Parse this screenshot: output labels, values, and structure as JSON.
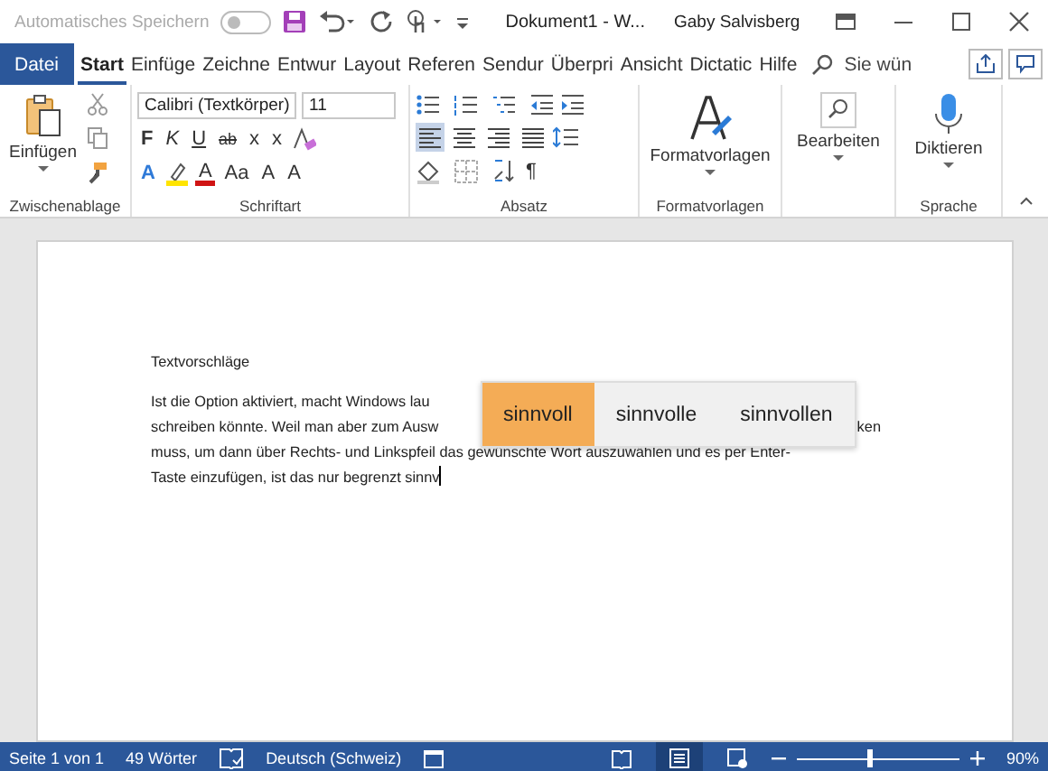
{
  "title_bar": {
    "autosave_label": "Automatisches Speichern",
    "autosave_on": false,
    "document_title": "Dokument1  -  W...",
    "user": "Gaby Salvisberg"
  },
  "tabs": [
    {
      "label": "Datei",
      "kind": "file",
      "selected": false
    },
    {
      "label": "Start",
      "kind": "tab",
      "selected": true
    },
    {
      "label": "Einfüge",
      "kind": "tab",
      "selected": false
    },
    {
      "label": "Zeichne",
      "kind": "tab",
      "selected": false
    },
    {
      "label": "Entwur",
      "kind": "tab",
      "selected": false
    },
    {
      "label": "Layout",
      "kind": "tab",
      "selected": false
    },
    {
      "label": "Referen",
      "kind": "tab",
      "selected": false
    },
    {
      "label": "Sendur",
      "kind": "tab",
      "selected": false
    },
    {
      "label": "Überpri",
      "kind": "tab",
      "selected": false
    },
    {
      "label": "Ansicht",
      "kind": "tab",
      "selected": false
    },
    {
      "label": "Dictatic",
      "kind": "tab",
      "selected": false
    },
    {
      "label": "Hilfe",
      "kind": "tab",
      "selected": false
    }
  ],
  "tell_me": {
    "placeholder": "Sie wün"
  },
  "ribbon": {
    "clipboard": {
      "paste": "Einfügen",
      "group": "Zwischenablage"
    },
    "font": {
      "name": "Calibri (Textkörper)",
      "size": "11",
      "row1": [
        "F",
        "K",
        "U",
        "ab",
        "x",
        "x"
      ],
      "row2": [
        "A",
        "A",
        "Aa",
        "A",
        "A"
      ],
      "group": "Schriftart"
    },
    "paragraph": {
      "alignments": [
        {
          "selected": true
        },
        {
          "selected": false
        },
        {
          "selected": false
        },
        {
          "selected": false
        }
      ],
      "pilcrow": "¶",
      "group": "Absatz"
    },
    "styles": {
      "label": "Formatvorlagen",
      "group": "Formatvorlagen"
    },
    "editing": {
      "label": "Bearbeiten"
    },
    "voice": {
      "label": "Diktieren",
      "group": "Sprache"
    }
  },
  "document": {
    "heading": "Textvorschläge",
    "lines": [
      {
        "left": "Ist die Option aktiviert, macht Windows lau"
      },
      {
        "left": "schreiben könnte. Weil man aber zum Ausw",
        "right": "ken"
      },
      {
        "left": "muss, um dann über Rechts- und Linkspfeil das gewünschte Wort auszuwählen und es per Enter-"
      },
      {
        "left": "Taste einzufügen, ist das nur begrenzt sinnv"
      }
    ],
    "suggestions": [
      {
        "label": "sinnvoll",
        "selected": true
      },
      {
        "label": "sinnvolle",
        "selected": false
      },
      {
        "label": "sinnvollen",
        "selected": false
      }
    ]
  },
  "status_bar": {
    "page": "Seite 1 von 1",
    "words": "49 Wörter",
    "language": "Deutsch (Schweiz)",
    "views": [
      {
        "selected": false
      },
      {
        "selected": true
      },
      {
        "selected": false
      }
    ],
    "zoom": {
      "level": 0.45
    },
    "zoom_label": "90%"
  }
}
